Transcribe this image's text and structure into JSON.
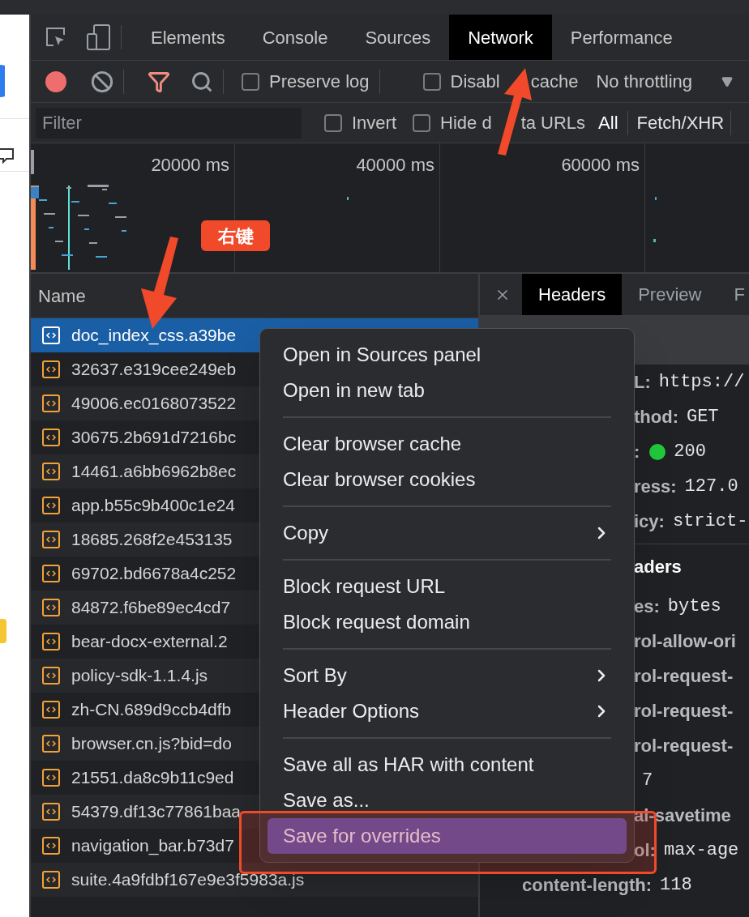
{
  "top_tabs": [
    {
      "label": "Elements",
      "selected": false
    },
    {
      "label": "Console",
      "selected": false
    },
    {
      "label": "Sources",
      "selected": false
    },
    {
      "label": "Network",
      "selected": true
    },
    {
      "label": "Performance",
      "selected": false
    }
  ],
  "toolbar": {
    "recording": true,
    "checkboxes": [
      {
        "label": "Preserve log",
        "checked": false
      },
      {
        "label_parts": [
          "Disabl",
          "cache"
        ],
        "checked": false
      }
    ],
    "throttling": "No throttling"
  },
  "filter_bar": {
    "placeholder": "Filter",
    "checkboxes": [
      {
        "label": "Invert",
        "checked": false
      },
      {
        "label_parts": [
          "Hide d",
          "ta URLs"
        ],
        "checked": false
      }
    ],
    "type_filters": [
      {
        "label": "All",
        "selected": true
      },
      {
        "label": "Fetch/XHR",
        "selected": false
      }
    ]
  },
  "timeline": {
    "ticks": [
      "20000 ms",
      "40000 ms",
      "60000 ms"
    ]
  },
  "requests": {
    "column": "Name",
    "rows": [
      {
        "name": "doc_index_css.a39be",
        "selected": true
      },
      {
        "name": "32637.e319cee249eb",
        "selected": false
      },
      {
        "name": "49006.ec0168073522",
        "selected": false
      },
      {
        "name": "30675.2b691d7216bc",
        "selected": false
      },
      {
        "name": "14461.a6bb6962b8ec",
        "selected": false
      },
      {
        "name": "app.b55c9b400c1e24",
        "selected": false
      },
      {
        "name": "18685.268f2e453135",
        "selected": false
      },
      {
        "name": "69702.bd6678a4c252",
        "selected": false
      },
      {
        "name": "84872.f6be89ec4cd7",
        "selected": false
      },
      {
        "name": "bear-docx-external.2",
        "selected": false
      },
      {
        "name": "policy-sdk-1.1.4.js",
        "selected": false
      },
      {
        "name": "zh-CN.689d9ccb4dfb",
        "selected": false
      },
      {
        "name": "browser.cn.js?bid=do",
        "selected": false
      },
      {
        "name": "21551.da8c9b11c9ed",
        "selected": false
      },
      {
        "name": "54379.df13c77861baa",
        "selected": false
      },
      {
        "name": "navigation_bar.b73d7",
        "selected": false
      },
      {
        "name": "suite.4a9fdbf167e9e3f5983a.js",
        "selected": false
      }
    ]
  },
  "details": {
    "tabs": [
      {
        "label": "Headers",
        "selected": true
      },
      {
        "label": "Preview",
        "selected": false
      },
      {
        "label": "F",
        "selected": false
      }
    ],
    "lines": [
      {
        "kind": "field",
        "key": "L:",
        "value": "https://"
      },
      {
        "kind": "field",
        "key": "thod:",
        "value": "GET"
      },
      {
        "kind": "status",
        "key": ":",
        "value": "200"
      },
      {
        "kind": "field",
        "key": "ress:",
        "value": "127.0"
      },
      {
        "kind": "field",
        "key": "icy:",
        "value": "strict-"
      },
      {
        "kind": "section",
        "key": "aders"
      },
      {
        "kind": "field",
        "key": "es:",
        "value": "bytes"
      },
      {
        "kind": "field",
        "key": "rol-allow-ori"
      },
      {
        "kind": "field",
        "key": "rol-request-"
      },
      {
        "kind": "field",
        "key": "rol-request-"
      },
      {
        "kind": "field",
        "key": "rol-request-"
      },
      {
        "kind": "field",
        "value": "7"
      },
      {
        "kind": "field",
        "key": "al-savetime"
      },
      {
        "kind": "field",
        "key": "ol:",
        "value": "max-age"
      },
      {
        "kind": "full",
        "key": "content-length:",
        "value": "118"
      }
    ]
  },
  "context_menu": [
    {
      "kind": "item",
      "label": "Open in Sources panel",
      "submenu": false,
      "selected": false
    },
    {
      "kind": "item",
      "label": "Open in new tab",
      "submenu": false,
      "selected": false
    },
    {
      "kind": "separator"
    },
    {
      "kind": "item",
      "label": "Clear browser cache",
      "submenu": false,
      "selected": false
    },
    {
      "kind": "item",
      "label": "Clear browser cookies",
      "submenu": false,
      "selected": false
    },
    {
      "kind": "separator"
    },
    {
      "kind": "item",
      "label": "Copy",
      "submenu": true,
      "selected": false
    },
    {
      "kind": "separator"
    },
    {
      "kind": "item",
      "label": "Block request URL",
      "submenu": false,
      "selected": false
    },
    {
      "kind": "item",
      "label": "Block request domain",
      "submenu": false,
      "selected": false
    },
    {
      "kind": "separator"
    },
    {
      "kind": "item",
      "label": "Sort By",
      "submenu": true,
      "selected": false
    },
    {
      "kind": "item",
      "label": "Header Options",
      "submenu": true,
      "selected": false
    },
    {
      "kind": "separator"
    },
    {
      "kind": "item",
      "label": "Save all as HAR with content",
      "submenu": false,
      "selected": false
    },
    {
      "kind": "item",
      "label": "Save as...",
      "submenu": false,
      "selected": false
    },
    {
      "kind": "item",
      "label": "Save for overrides",
      "submenu": false,
      "selected": true
    }
  ],
  "annotation": {
    "label": "右键"
  }
}
